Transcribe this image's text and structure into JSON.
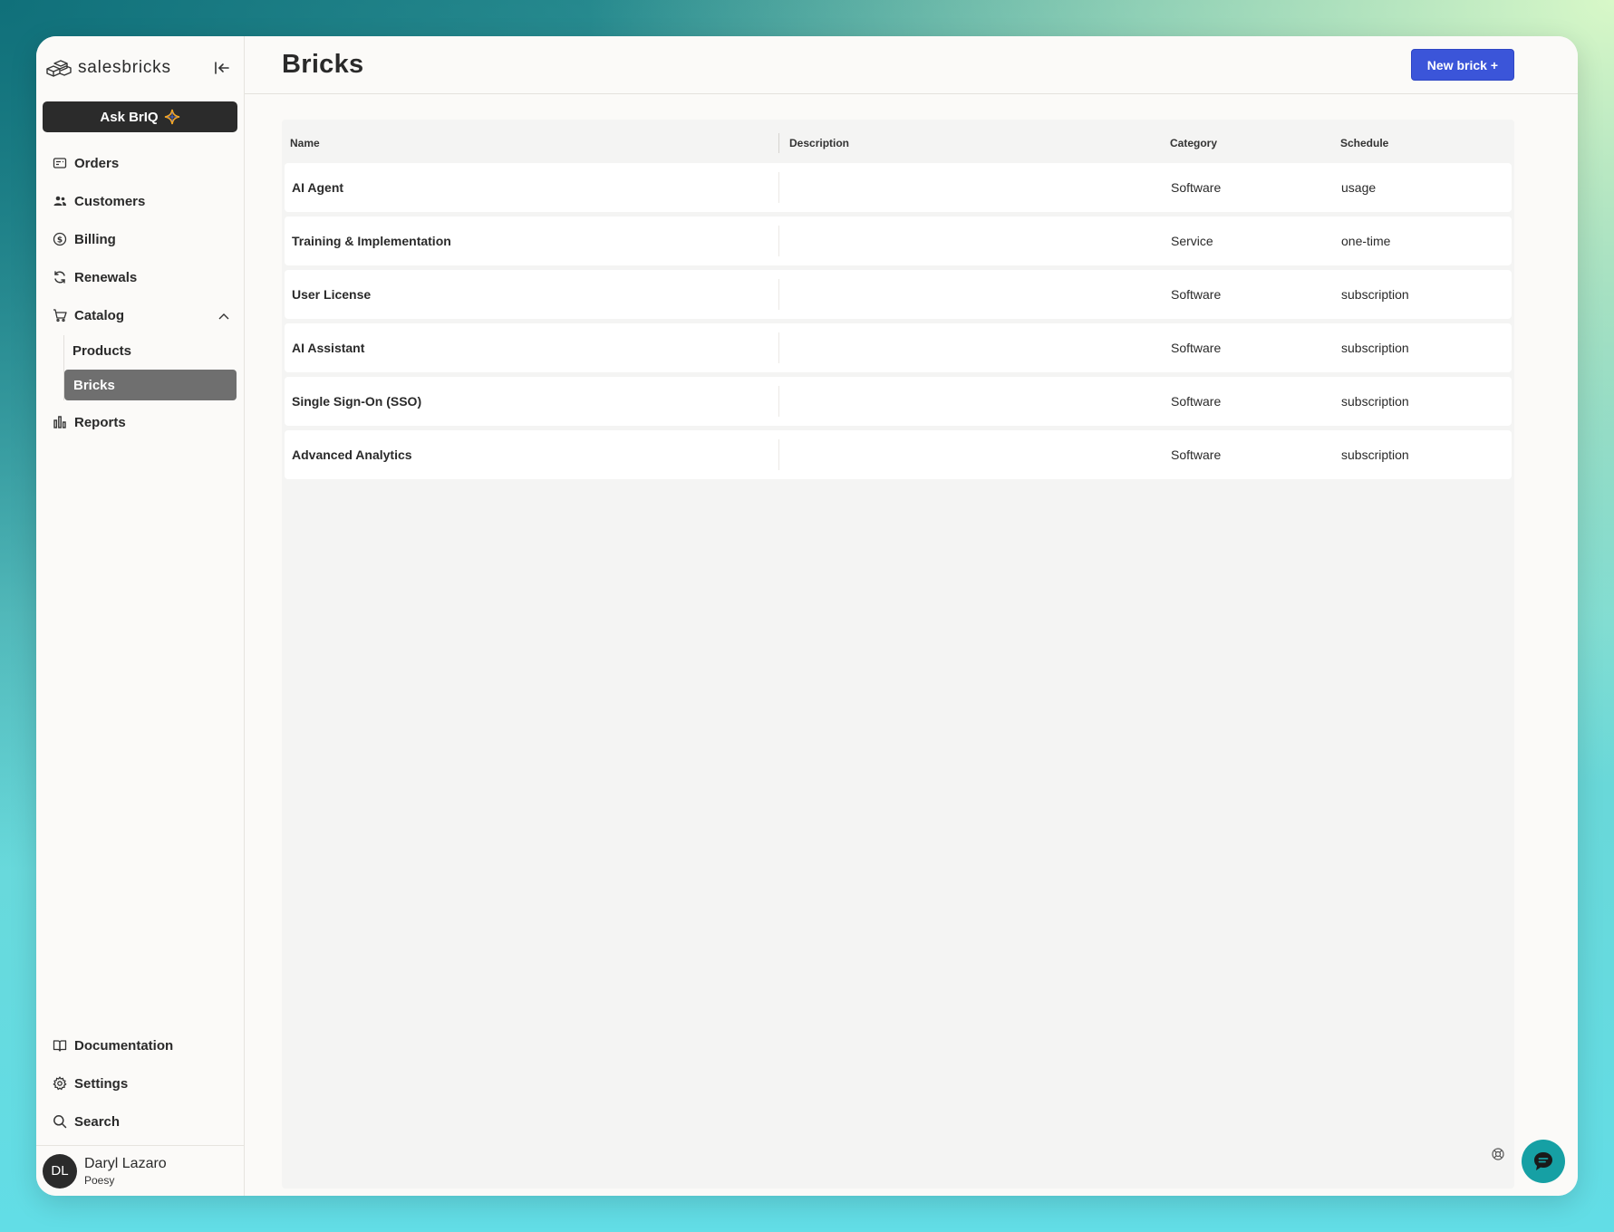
{
  "app": {
    "brand": "salesbricks",
    "ask_button": "Ask BrIQ"
  },
  "sidebar": {
    "items": [
      {
        "label": "Orders",
        "icon": "orders-icon"
      },
      {
        "label": "Customers",
        "icon": "customers-icon"
      },
      {
        "label": "Billing",
        "icon": "billing-icon"
      },
      {
        "label": "Renewals",
        "icon": "renewals-icon"
      },
      {
        "label": "Catalog",
        "icon": "cart-icon"
      }
    ],
    "catalog_sub": [
      {
        "label": "Products"
      },
      {
        "label": "Bricks",
        "active": true
      }
    ],
    "reports": {
      "label": "Reports",
      "icon": "bar-chart-icon"
    },
    "bottom": [
      {
        "label": "Documentation",
        "icon": "book-icon"
      },
      {
        "label": "Settings",
        "icon": "gear-icon"
      },
      {
        "label": "Search",
        "icon": "search-icon"
      }
    ],
    "user": {
      "initials": "DL",
      "name": "Daryl Lazaro",
      "org": "Poesy"
    }
  },
  "header": {
    "title": "Bricks",
    "new_button": "New brick +"
  },
  "table": {
    "columns": [
      "Name",
      "Description",
      "Category",
      "Schedule"
    ],
    "rows": [
      {
        "name": "AI Agent",
        "description": "",
        "category": "Software",
        "schedule": "usage"
      },
      {
        "name": "Training & Implementation",
        "description": "",
        "category": "Service",
        "schedule": "one-time"
      },
      {
        "name": "User License",
        "description": "",
        "category": "Software",
        "schedule": "subscription"
      },
      {
        "name": "AI Assistant",
        "description": "",
        "category": "Software",
        "schedule": "subscription"
      },
      {
        "name": "Single Sign-On (SSO)",
        "description": "",
        "category": "Software",
        "schedule": "subscription"
      },
      {
        "name": "Advanced Analytics",
        "description": "",
        "category": "Software",
        "schedule": "subscription"
      }
    ]
  },
  "colors": {
    "accent": "#3b55d9",
    "chat": "#16a0a4",
    "active_nav": "#6f6f6f"
  }
}
